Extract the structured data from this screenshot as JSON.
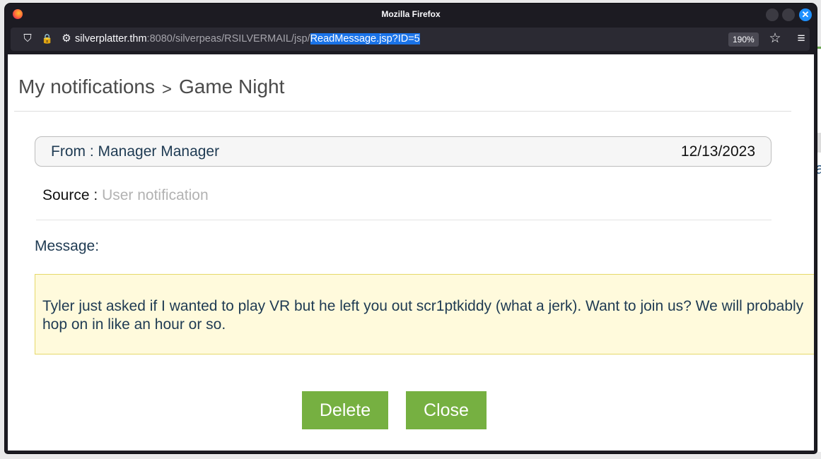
{
  "browser": {
    "window_title": "Mozilla Firefox",
    "close_glyph": "✕",
    "url": {
      "host": "silverplatter.thm",
      "path": ":8080/silverpeas/RSILVERMAIL/jsp/",
      "selected": "ReadMessage.jsp?ID=5"
    },
    "zoom": "190%",
    "icons": {
      "shield": "⛉",
      "lock": "🔒",
      "permissions": "⚙",
      "star": "☆",
      "menu": "≡"
    }
  },
  "page": {
    "breadcrumb": {
      "parent": "My notifications",
      "separator": ">",
      "current": "Game Night"
    },
    "from": {
      "label": "From : Manager Manager",
      "date": "12/13/2023"
    },
    "source": {
      "label": "Source :",
      "value": "User notification"
    },
    "message": {
      "label": "Message:",
      "body": "Tyler just asked if I wanted to play VR but he left you out scr1ptkiddy (what a jerk). Want to join us? We will probably hop on in like an hour or so."
    },
    "buttons": {
      "delete": "Delete",
      "close": "Close"
    }
  },
  "background": {
    "peek_letter": "a"
  },
  "colors": {
    "accent_green": "#76b041",
    "message_bg": "#fffadc",
    "selection": "#1a73e8"
  }
}
